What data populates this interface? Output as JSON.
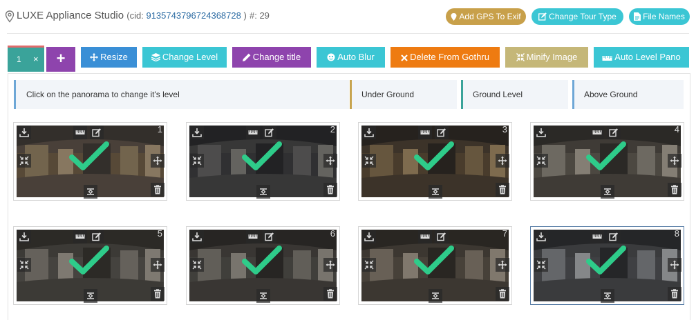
{
  "header": {
    "title": "LUXE Appliance Studio",
    "cid_prefix": "(cid:",
    "cid_value": "9135743796724368728",
    "cid_suffix": ")",
    "count_text": "#: 29",
    "buttons": {
      "gps": "Add GPS To Exif",
      "tour_type": "Change Tour Type",
      "file_names": "File Names"
    }
  },
  "toolbar": {
    "tab_number": "1",
    "tab_close": "×",
    "add_label": "+",
    "resize": "Resize",
    "change_level": "Change Level",
    "change_title": "Change title",
    "auto_blur": "Auto Blur",
    "delete_gothru": "Delete From Gothru",
    "minify": "Minify Image",
    "auto_level": "Auto Level Pano"
  },
  "info": {
    "hint": "Click on the panorama to change it's level",
    "levels": [
      "Under Ground",
      "Ground Level",
      "Above Ground"
    ]
  },
  "panoramas": [
    {
      "number": "1"
    },
    {
      "number": "2"
    },
    {
      "number": "3"
    },
    {
      "number": "4"
    },
    {
      "number": "5"
    },
    {
      "number": "6"
    },
    {
      "number": "7"
    },
    {
      "number": "8"
    }
  ],
  "colors": {
    "gps": "#c8a04a",
    "tour_type": "#3bc6d4",
    "file_names": "#3bc6d4",
    "resize": "#3a8fd6",
    "change_level": "#3bc6d4",
    "change_title": "#8e44ad",
    "auto_blur": "#3bc6d4",
    "delete": "#ee7b11",
    "minify": "#c5b778",
    "auto_level": "#3bc6d4",
    "check": "#2ecc8a",
    "level_under": "#c7a44f",
    "level_ground": "#3aa39a",
    "level_above": "#6ea7d6"
  }
}
